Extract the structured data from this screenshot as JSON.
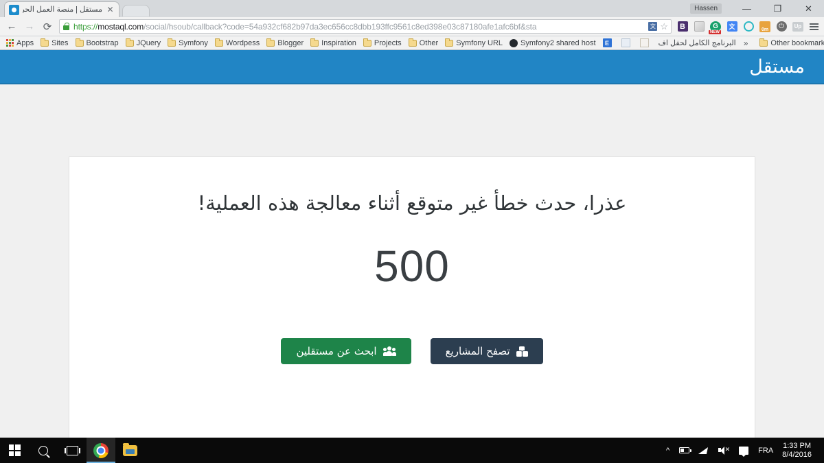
{
  "browser": {
    "tab": {
      "title": "مستقل | منصة العمل الحر ا",
      "close_label": "✕"
    },
    "window_controls": {
      "profile_name": "Hassen",
      "minimize": "—",
      "maximize": "❐",
      "close": "✕"
    },
    "nav": {
      "back": "←",
      "forward": "→",
      "reload": "⟳"
    },
    "omnibox": {
      "scheme": "https://",
      "host": "mostaql.com",
      "path": "/social/hsoub/callback?code=54a932cf682b97da3ec656cc8dbb193ffc9561c8ed398e03c87180afe1afc6bf&sta",
      "translate_icon": "translate-icon",
      "bookmark_star": "☆"
    },
    "extensions": [
      {
        "name": "bitwarden-extension",
        "label": "B"
      },
      {
        "name": "cube-extension",
        "label": ""
      },
      {
        "name": "grammarly-extension",
        "label": "G",
        "badge": "NEW"
      },
      {
        "name": "google-translate-extension",
        "label": "文"
      },
      {
        "name": "clock-extension",
        "label": ""
      },
      {
        "name": "timer-extension",
        "label": "0m"
      },
      {
        "name": "power-extension",
        "label": "⏻"
      },
      {
        "name": "up-extension",
        "label": "Up"
      }
    ],
    "bookmarks": [
      {
        "name": "apps",
        "label": "Apps",
        "icon": "apps-grid-icon"
      },
      {
        "name": "sites",
        "label": "Sites",
        "icon": "folder-icon"
      },
      {
        "name": "bootstrap",
        "label": "Bootstrap",
        "icon": "folder-icon"
      },
      {
        "name": "jquery",
        "label": "JQuery",
        "icon": "folder-icon"
      },
      {
        "name": "symfony",
        "label": "Symfony",
        "icon": "folder-icon"
      },
      {
        "name": "wordpess",
        "label": "Wordpess",
        "icon": "folder-icon"
      },
      {
        "name": "blogger",
        "label": "Blogger",
        "icon": "folder-icon"
      },
      {
        "name": "inspiration",
        "label": "Inspiration",
        "icon": "folder-icon"
      },
      {
        "name": "projects",
        "label": "Projects",
        "icon": "folder-icon"
      },
      {
        "name": "other",
        "label": "Other",
        "icon": "folder-icon"
      },
      {
        "name": "symfony-url",
        "label": "Symfony URL",
        "icon": "folder-icon"
      },
      {
        "name": "symfony2-shared-host",
        "label": "Symfony2 shared host",
        "icon": "github-icon"
      }
    ],
    "bookmarks_favicons": [
      {
        "name": "evernote-bookmark",
        "label": "E"
      },
      {
        "name": "image-bookmark",
        "label": ""
      },
      {
        "name": "doc-bookmark",
        "label": ""
      }
    ],
    "bookmark_arabic": "البرنامج الكامل لحفل اف",
    "bookmarks_overflow": "»",
    "other_bookmarks": "Other bookmarks"
  },
  "page": {
    "header": {
      "logo_text": "مستقل"
    },
    "error": {
      "title": "عذرا، حدث خطأ غير متوقع أثناء معالجة هذه العملية!",
      "code": "500"
    },
    "buttons": [
      {
        "name": "browse-projects-button",
        "label": "تصفح المشاريع",
        "icon": "cubes-icon",
        "color": "#2c3e50"
      },
      {
        "name": "find-freelancers-button",
        "label": "ابحث عن مستقلين",
        "icon": "users-icon",
        "color": "#1e8449"
      }
    ],
    "colors": {
      "header_blue": "#2185c5",
      "page_background": "#f0f0f0",
      "card_background": "#ffffff"
    }
  },
  "taskbar": {
    "start": "windows-logo",
    "search": "search-icon",
    "task_view": "task-view-icon",
    "apps": [
      {
        "name": "chrome-taskbar-icon",
        "label": "Google Chrome"
      },
      {
        "name": "file-explorer-taskbar-icon",
        "label": "File Explorer"
      }
    ],
    "tray": {
      "overflow": "^",
      "battery": "battery-icon",
      "network": "wifi-icon",
      "volume": "volume-muted-icon",
      "action_center": "notification-icon",
      "language": "FRA",
      "time": "1:33 PM",
      "date": "8/4/2016"
    }
  }
}
